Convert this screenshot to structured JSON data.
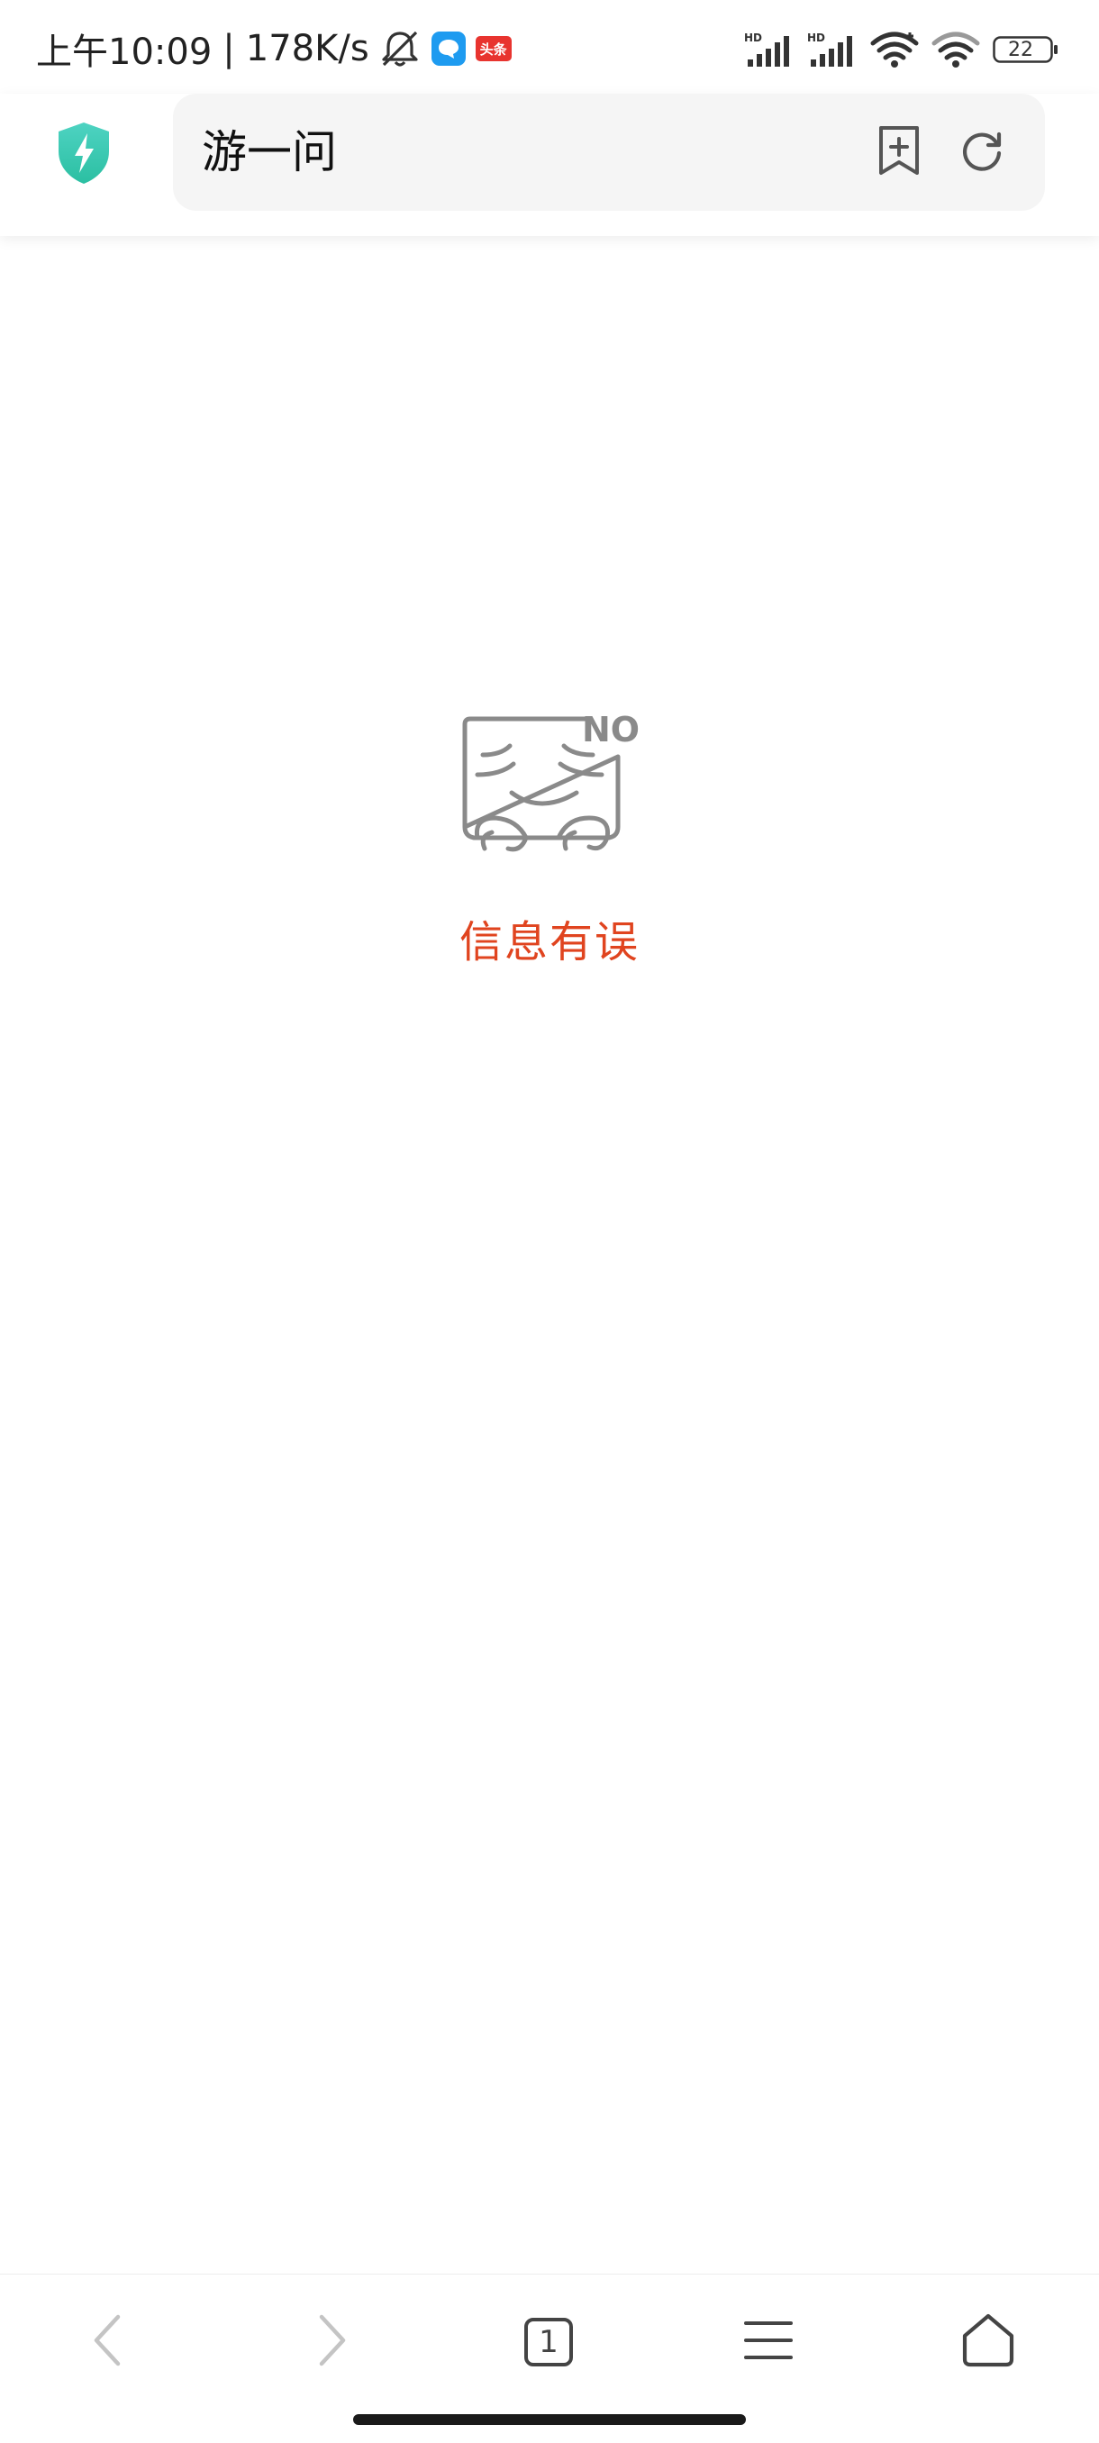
{
  "status_bar": {
    "time": "上午10:09",
    "separator": "|",
    "network_speed": "178K/s",
    "app_badge": "头条",
    "battery_level": "22"
  },
  "top_bar": {
    "address_text": "游一问"
  },
  "empty_state": {
    "message": "信息有误",
    "illustration_badge": "NO"
  },
  "bottom_nav": {
    "tab_count": "1"
  },
  "colors": {
    "accent_shield": "#3ccfb5",
    "error_text": "#e0441f",
    "icon_gray": "#555555"
  },
  "icons": {
    "shield": "shield-bolt-icon",
    "bookmark_add": "bookmark-add-icon",
    "refresh": "refresh-icon",
    "back": "back-arrow-icon",
    "forward": "forward-arrow-icon",
    "tabs": "tabs-icon",
    "menu": "menu-icon",
    "home": "home-icon"
  }
}
